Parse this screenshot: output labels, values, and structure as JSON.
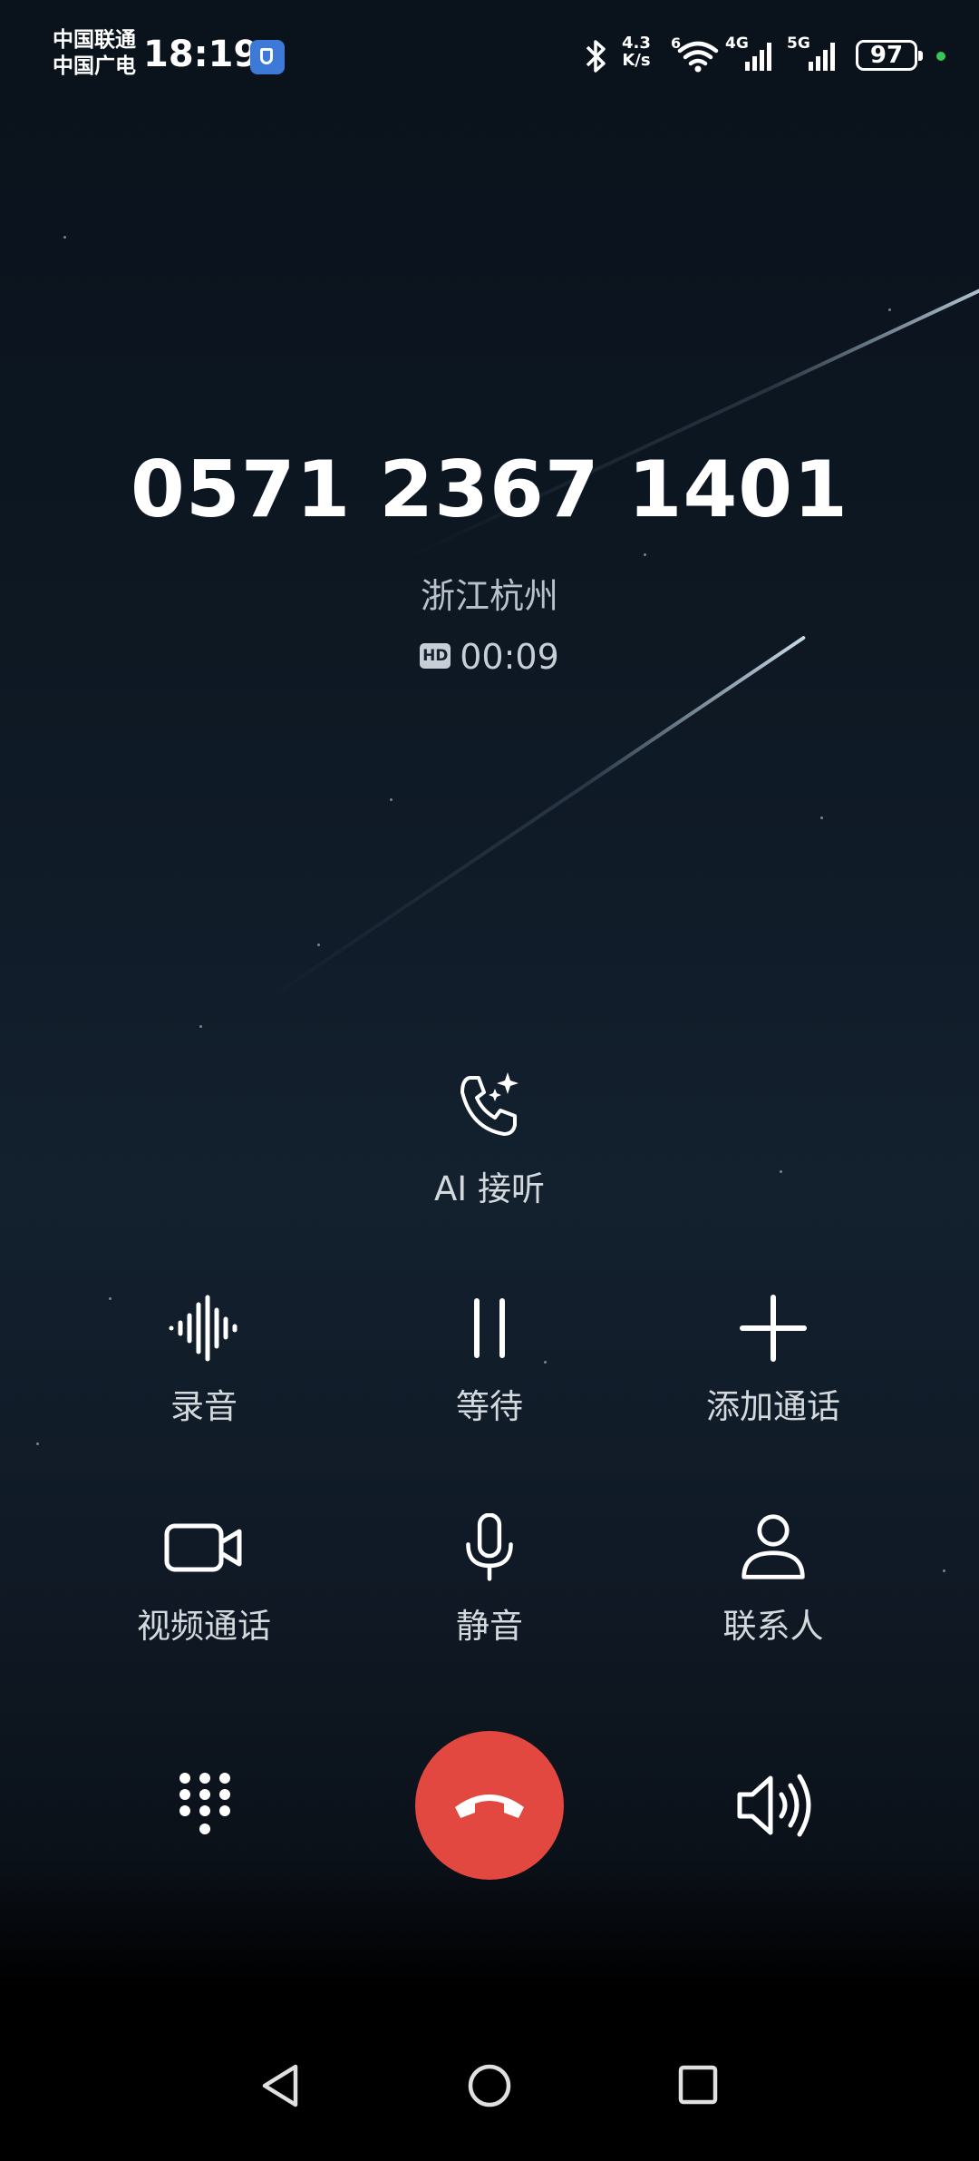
{
  "status_bar": {
    "carrier_1": "中国联通",
    "carrier_2": "中国广电",
    "time": "18:19",
    "net_speed_value": "4.3",
    "net_speed_unit": "K/s",
    "wifi_badge": "6",
    "cell_1": "4G",
    "cell_2": "5G",
    "battery": "97",
    "icons": [
      "shield-app-icon",
      "bluetooth-icon",
      "wifi-icon",
      "signal-icon",
      "battery-icon"
    ]
  },
  "call": {
    "number": "0571 2367 1401",
    "location": "浙江杭州",
    "hd_badge": "HD",
    "duration": "00:09"
  },
  "ai_answer": {
    "label": "AI 接听",
    "icon": "ai-phone-sparkle-icon"
  },
  "actions": [
    {
      "label": "录音",
      "icon": "record-waveform-icon"
    },
    {
      "label": "等待",
      "icon": "pause-icon"
    },
    {
      "label": "添加通话",
      "icon": "plus-icon"
    },
    {
      "label": "视频通话",
      "icon": "video-camera-icon"
    },
    {
      "label": "静音",
      "icon": "microphone-icon"
    },
    {
      "label": "联系人",
      "icon": "person-icon"
    }
  ],
  "controls": {
    "dialpad_icon": "dialpad-icon",
    "hangup_icon": "hangup-icon",
    "hangup_color": "#e2483f",
    "speaker_icon": "speaker-icon"
  },
  "nav": {
    "icons": [
      "back-icon",
      "home-icon",
      "recents-icon"
    ]
  }
}
